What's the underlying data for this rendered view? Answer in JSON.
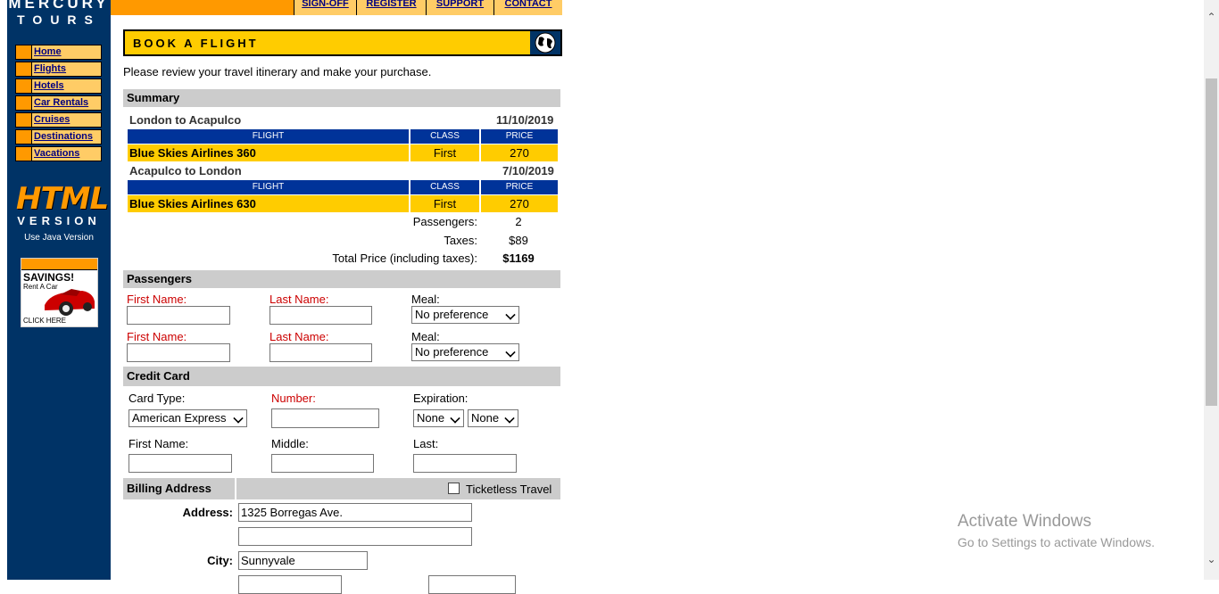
{
  "logo": {
    "line1": "MERCURY",
    "line2": "TOURS"
  },
  "top_nav": [
    "SIGN-OFF",
    "REGISTER",
    "SUPPORT",
    "CONTACT"
  ],
  "side_nav": [
    "Home",
    "Flights",
    "Hotels",
    "Car Rentals",
    "Cruises",
    "Destinations",
    "Vacations"
  ],
  "html_version": {
    "big": "HTML",
    "sub": "VERSION",
    "java": "Use Java Version"
  },
  "ad": {
    "title": "SAVINGS!",
    "sub": "Rent A Car",
    "click": "CLICK HERE"
  },
  "header": {
    "title": "BOOK A FLIGHT"
  },
  "intro": "Please review your travel itinerary and make your purchase.",
  "summary": {
    "title": "Summary",
    "legs": [
      {
        "route": "London to Acapulco",
        "date": "11/10/2019",
        "flight": "Blue Skies Airlines 360",
        "class": "First",
        "price": "270"
      },
      {
        "route": "Acapulco to London",
        "date": "7/10/2019",
        "flight": "Blue Skies Airlines 630",
        "class": "First",
        "price": "270"
      }
    ],
    "col_flight": "FLIGHT",
    "col_class": "CLASS",
    "col_price": "PRICE",
    "passengers_label": "Passengers:",
    "passengers": "2",
    "taxes_label": "Taxes:",
    "taxes": "$89",
    "total_label": "Total Price (including taxes):",
    "total": "$1169"
  },
  "passengers_section": {
    "title": "Passengers",
    "first_label": "First Name:",
    "last_label": "Last Name:",
    "meal_label": "Meal:",
    "meal_value": "No preference"
  },
  "credit_card": {
    "title": "Credit Card",
    "card_type_label": "Card Type:",
    "card_type_value": "American Express",
    "number_label": "Number:",
    "expiration_label": "Expiration:",
    "exp_month": "None",
    "exp_year": "None",
    "first_label": "First Name:",
    "middle_label": "Middle:",
    "last_label": "Last:"
  },
  "billing": {
    "title": "Billing Address",
    "ticketless": "Ticketless Travel",
    "address_label": "Address:",
    "address1": "1325 Borregas Ave.",
    "address2": "",
    "city_label": "City:",
    "city": "Sunnyvale"
  },
  "watermark": {
    "line1": "Activate Windows",
    "line2": "Go to Settings to activate Windows."
  }
}
